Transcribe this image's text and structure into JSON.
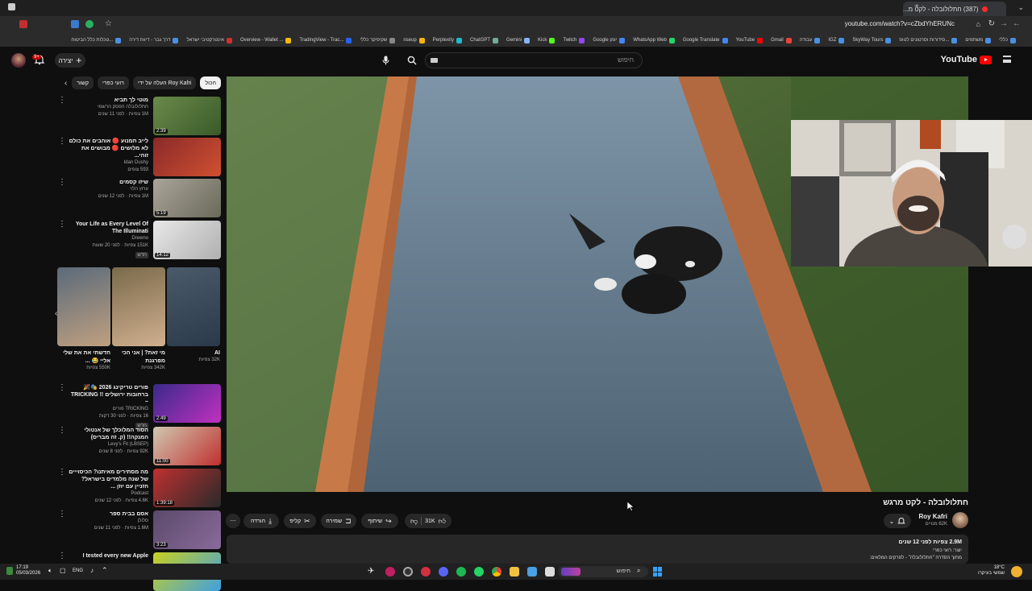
{
  "browser": {
    "tab_title": "(387) חתלולובלה - לקט מ...",
    "url": "youtube.com/watch?v=cZbdYhERUNc",
    "bookmarks": [
      {
        "label": "כללי",
        "color": "#4a90e2"
      },
      {
        "label": "משתפים",
        "color": "#4a90e2"
      },
      {
        "label": "סידורות וסרטונים לטופ...",
        "color": "#4a90e2"
      },
      {
        "label": "SkyWay Tours",
        "color": "#4a90e2"
      },
      {
        "label": "IGZ",
        "color": "#4a90e2"
      },
      {
        "label": "עבודה",
        "color": "#4a90e2"
      },
      {
        "label": "Gmail",
        "color": "#ea4335"
      },
      {
        "label": "YouTube",
        "color": "#ff0000"
      },
      {
        "label": "Google Translate",
        "color": "#4285f4"
      },
      {
        "label": "WhatsApp Web",
        "color": "#25d366"
      },
      {
        "label": "Google יומן",
        "color": "#4285f4"
      },
      {
        "label": "Twitch",
        "color": "#9146ff"
      },
      {
        "label": "Kick",
        "color": "#53fc18"
      },
      {
        "label": "Gemini",
        "color": "#8ab4f8"
      },
      {
        "label": "ChatGPT",
        "color": "#74aa9c"
      },
      {
        "label": "Perplexity",
        "color": "#20b8cd"
      },
      {
        "label": "nseup",
        "color": "#f4b400"
      },
      {
        "label": "שקיפיקר כללי",
        "color": "#888888"
      },
      {
        "label": "TradingView - Trac...",
        "color": "#2962ff"
      },
      {
        "label": "Overview - Wallet ...",
        "color": "#f0b90b"
      },
      {
        "label": "אינטרקטיבי ישראל",
        "color": "#d32f2f"
      },
      {
        "label": "דרך גבר - דיווח דירה",
        "color": "#4a90e2"
      },
      {
        "label": "טכלות כלל הביטוח...",
        "color": "#4a90e2"
      }
    ]
  },
  "youtube": {
    "search_placeholder": "חיפוש",
    "create_label": "יצירה",
    "notification_count": "9+",
    "logo_text": "YouTube"
  },
  "chips": [
    {
      "label": "הכול",
      "active": true
    },
    {
      "label": "העלה על ידי Roy Kafri",
      "active": false
    },
    {
      "label": "רועי כפרי",
      "active": false
    },
    {
      "label": "קשור",
      "active": false
    }
  ],
  "related": [
    {
      "title": "מוטי לך תביא",
      "channel": "חתלולובלה הפסק הרשמי",
      "views": "1M צפיות · לפני 11 שנים",
      "duration": "2:39",
      "colors": [
        "#6a8a4a",
        "#3a5a2a"
      ]
    },
    {
      "title": "לייב תמנוע 🔴 אוהבים את כולם לא מלושים 🔴 מבושים את זוהי...",
      "channel": "Idan Dushy",
      "views": "593 צופים",
      "duration": "",
      "colors": [
        "#8a2a2a",
        "#d05030"
      ]
    },
    {
      "title": "שיזו קסמים",
      "channel": "ערוץ הלוי",
      "views": "1M צפיות · לפני 12 שנים",
      "duration": "5:19",
      "colors": [
        "#aaa49a",
        "#6a6a5a"
      ]
    },
    {
      "title": "Your Life as Every Level Of The Illuminati",
      "channel": "Drewno",
      "views": "151K צפיות · לפני 20 שעות",
      "duration": "14:12",
      "colors": [
        "#e8e8e8",
        "#b0b0b0"
      ],
      "badge": "חדש"
    },
    {
      "title": "פורים טריקינג 2026 🎭🎉 ברחובות ירושלים !! TRICKING ~",
      "channel": "TRICKING פורים",
      "views": "16 צפיות · לפני 30 דקות",
      "duration": "2:49",
      "colors": [
        "#3a2a8a",
        "#c030c0"
      ],
      "badge": "חדש"
    },
    {
      "title": "הסוד המלוכלך של אנטולי המנקה!! (ק. זה מבריס)",
      "channel": "Levy's Fit (LBSEP)",
      "views": "92K צפיות · לפני 8 שנים",
      "duration": "11:00",
      "colors": [
        "#d0c8b0",
        "#c03030"
      ]
    },
    {
      "title": "מה מסתירים מאיתנו? הכיסוייים של שנה מלמדים בישראל? חזניין עם יוזן ...",
      "channel": "Podcast",
      "views": "4.6K צפיות · לפני 12 שנים",
      "duration": "1:39:18",
      "colors": [
        "#c03030",
        "#2a2a2a"
      ]
    },
    {
      "title": "אסם בבית ספר",
      "channel": "סלולן",
      "views": "1.6M צפיות · לפני 11 שנים",
      "duration": "3:23",
      "colors": [
        "#5a4a6a",
        "#8a6a9a"
      ]
    },
    {
      "title": "I tested every new Apple",
      "channel": "",
      "views": "",
      "duration": "",
      "colors": [
        "#c8d020",
        "#40a0e0"
      ]
    }
  ],
  "shorts": [
    {
      "title": "AI",
      "views": "32K צפיות",
      "colors": [
        "#4a5a6a",
        "#2a3a4a"
      ]
    },
    {
      "title": "מי זאת? | אני הכי מפרגנת",
      "views": "342K צפיות",
      "colors": [
        "#7a6a4a",
        "#d0b090"
      ]
    },
    {
      "title": "חדשתי את את שלי אליי 😂 ...",
      "views": "550K צפיות",
      "colors": [
        "#5a6a7a",
        "#c0a080"
      ]
    }
  ],
  "video": {
    "title": "חתלולובלה - לקט מרגש",
    "channel": "Roy Kafri",
    "subscribers": "62K מנויים",
    "likes": "31K",
    "share_label": "שיתוף",
    "save_label": "שמירה",
    "clip_label": "קליפ",
    "download_label": "הורדה",
    "desc_line1": "2.9M צפיות  לפני 12 שנים",
    "desc_line2": "יוצר: רועי כפרי",
    "desc_line3": "מתוך הסדרה \"חתלולובלה\" - לפרקים המלאים:"
  },
  "taskbar": {
    "search_placeholder": "חיפוש",
    "time": "17:19",
    "date": "05/03/2026",
    "lang": "ENG",
    "weather_temp": "18°C",
    "weather_desc": "שמשי בעיקרו"
  }
}
